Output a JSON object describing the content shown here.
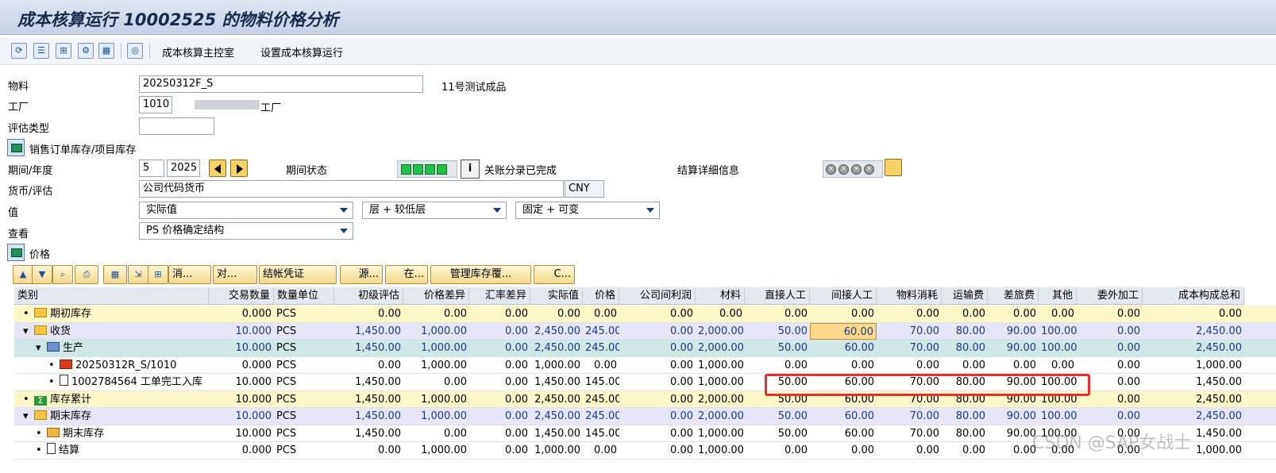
{
  "window": {
    "title": "成本核算运行 10002525 的物料价格分析"
  },
  "toolbar": {
    "link1": "成本核算主控室",
    "link2": "设置成本核算运行"
  },
  "header": {
    "material_label": "物料",
    "material_value": "20250312F_S",
    "material_desc": "11号测试成品",
    "plant_label": "工厂",
    "plant_value": "1010",
    "plant_desc": "工厂",
    "valtype_label": "评估类型",
    "valtype_value": "",
    "sales_stock_label": "销售订单库存/项目库存",
    "period_label": "期间/年度",
    "period_value": "5",
    "year_value": "2025",
    "period_status_label": "期间状态",
    "closing_status": "关账分录已完成",
    "settle_label": "结算详细信息",
    "currency_label": "货币/评估",
    "currency_value": "公司代码货币",
    "currency_code": "CNY",
    "value_label": "值",
    "value_select": "实际值",
    "level_select": "层 + 较低层",
    "fixvar_select": "固定 + 可变",
    "view_label": "查看",
    "view_select": "PS 价格确定结构",
    "price_label": "价格"
  },
  "grid_toolbar": {
    "b_msg": "消...",
    "b_recon": "对...",
    "b_post": "结帐凭证",
    "b_src": "源...",
    "b_in": "在...",
    "b_stock": "管理库存覆...",
    "b_c": "C..."
  },
  "columns": [
    "类别",
    "交易数量",
    "数量单位",
    "初级评估",
    "价格差异",
    "汇率差异",
    "实际值",
    "价格",
    "公司间利润",
    "材料",
    "直接人工",
    "间接人工",
    "物料消耗",
    "运输费",
    "差旅费",
    "其他",
    "委外加工",
    "成本构成总和"
  ],
  "rows": [
    {
      "label": "期初库存",
      "cells": [
        "0.000",
        "PCS",
        "0.00",
        "0.00",
        "0.00",
        "0.00",
        "0.00",
        "0.00",
        "0.00",
        "0.00",
        "0.00",
        "0.00",
        "0.00",
        "0.00",
        "0.00",
        "0.00",
        "0.00"
      ]
    },
    {
      "label": "收货",
      "cells": [
        "10.000",
        "PCS",
        "1,450.00",
        "1,000.00",
        "0.00",
        "2,450.00",
        "245.00",
        "0.00",
        "2,000.00",
        "50.00",
        "60.00",
        "70.00",
        "80.00",
        "90.00",
        "100.00",
        "0.00",
        "2,450.00"
      ]
    },
    {
      "label": "生产",
      "cells": [
        "10.000",
        "PCS",
        "1,450.00",
        "1,000.00",
        "0.00",
        "2,450.00",
        "245.00",
        "0.00",
        "2,000.00",
        "50.00",
        "60.00",
        "70.00",
        "80.00",
        "90.00",
        "100.00",
        "0.00",
        "2,450.00"
      ]
    },
    {
      "label": "20250312R_S/1010",
      "cells": [
        "0.000",
        "PCS",
        "0.00",
        "1,000.00",
        "0.00",
        "1,000.00",
        "0.00",
        "0.00",
        "1,000.00",
        "0.00",
        "0.00",
        "0.00",
        "0.00",
        "0.00",
        "0.00",
        "0.00",
        "1,000.00"
      ]
    },
    {
      "label": "1002784564 工单完工入库",
      "cells": [
        "10.000",
        "PCS",
        "1,450.00",
        "0.00",
        "0.00",
        "1,450.00",
        "145.00",
        "0.00",
        "1,000.00",
        "50.00",
        "60.00",
        "70.00",
        "80.00",
        "90.00",
        "100.00",
        "0.00",
        "1,450.00"
      ]
    },
    {
      "label": "库存累计",
      "cells": [
        "10.000",
        "PCS",
        "1,450.00",
        "1,000.00",
        "0.00",
        "2,450.00",
        "245.00",
        "0.00",
        "2,000.00",
        "50.00",
        "60.00",
        "70.00",
        "80.00",
        "90.00",
        "100.00",
        "0.00",
        "2,450.00"
      ]
    },
    {
      "label": "期末库存",
      "cells": [
        "10.000",
        "PCS",
        "1,450.00",
        "1,000.00",
        "0.00",
        "2,450.00",
        "245.00",
        "0.00",
        "2,000.00",
        "50.00",
        "60.00",
        "70.00",
        "80.00",
        "90.00",
        "100.00",
        "0.00",
        "2,450.00"
      ]
    },
    {
      "label": "期末库存",
      "cells": [
        "10.000",
        "PCS",
        "1,450.00",
        "0.00",
        "0.00",
        "1,450.00",
        "145.00",
        "0.00",
        "1,000.00",
        "50.00",
        "60.00",
        "70.00",
        "80.00",
        "90.00",
        "100.00",
        "0.00",
        "1,450.00"
      ]
    },
    {
      "label": "结算",
      "cells": [
        "0.000",
        "PCS",
        "0.00",
        "1,000.00",
        "0.00",
        "1,000.00",
        "0.00",
        "0.00",
        "1,000.00",
        "0.00",
        "0.00",
        "0.00",
        "0.00",
        "0.00",
        "0.00",
        "0.00",
        "1,000.00"
      ]
    }
  ],
  "watermark": "CSDN @SAP女战士"
}
